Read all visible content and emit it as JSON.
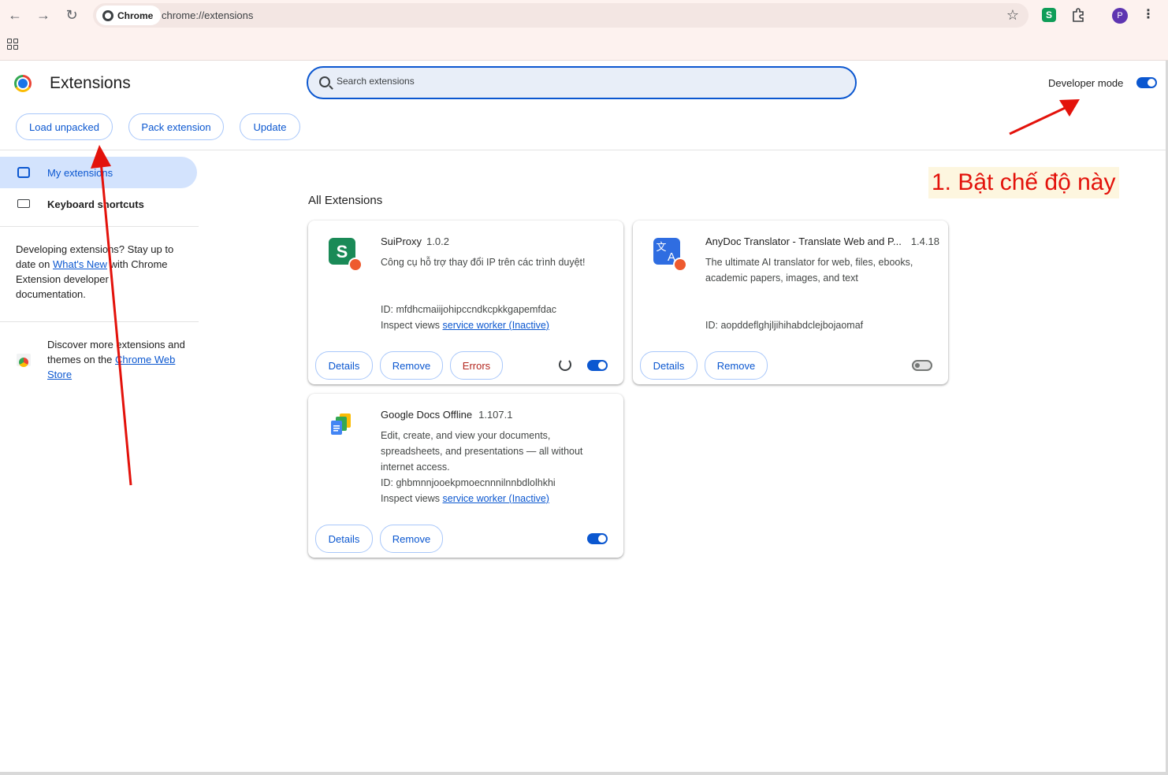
{
  "browser": {
    "chip_label": "Chrome",
    "url": "chrome://extensions",
    "profile_initial": "P",
    "suiproxy_toolbar_letter": "S"
  },
  "header": {
    "title": "Extensions",
    "search_placeholder": "Search extensions",
    "developer_mode_label": "Developer mode",
    "developer_mode_on": true
  },
  "actions": {
    "load_unpacked": "Load unpacked",
    "pack_extension": "Pack extension",
    "update": "Update"
  },
  "sidebar": {
    "items": [
      {
        "label": "My extensions",
        "icon": "puzzle-icon",
        "active": true
      },
      {
        "label": "Keyboard shortcuts",
        "icon": "keyboard-icon",
        "active": false
      }
    ],
    "dev_text_1": "Developing extensions? Stay up to date on ",
    "dev_link": "What's New",
    "dev_text_2": " with Chrome Extension developer documentation.",
    "store_text": "Discover more extensions and themes on the ",
    "store_link": "Chrome Web Store"
  },
  "main": {
    "section_title": "All Extensions",
    "extensions": [
      {
        "name": "SuiProxy",
        "version": "1.0.2",
        "description": "Công cụ hỗ trợ thay đổi IP trên các trình duyệt!",
        "id_line": "ID: mfdhcmaiijohipccndkcpkkgapemfdac",
        "inspect_label": "Inspect views ",
        "inspect_link": "service worker (Inactive)",
        "details": "Details",
        "remove": "Remove",
        "errors": "Errors",
        "enabled": true
      },
      {
        "name": "AnyDoc Translator - Translate Web and P...",
        "version": "1.4.18",
        "description": "The ultimate AI translator for web, files, ebooks, academic papers, images, and text",
        "id_line": "ID: aopddeflghjljihihabdclejbojaomaf",
        "details": "Details",
        "remove": "Remove",
        "enabled": false
      },
      {
        "name": "Google Docs Offline",
        "version": "1.107.1",
        "description": "Edit, create, and view your documents, spreadsheets, and presentations — all without internet access.",
        "id_line": "ID: ghbmnnjooekpmoecnnnilnnbdlolhkhi",
        "inspect_label": "Inspect views ",
        "inspect_link": "service worker (Inactive)",
        "details": "Details",
        "remove": "Remove",
        "enabled": true
      }
    ]
  },
  "annotation": {
    "text": "1. Bật chế độ này",
    "color": "#e3120b"
  },
  "colors": {
    "accent": "#0b57d0",
    "toolbar_bg": "#fdf2ef"
  }
}
